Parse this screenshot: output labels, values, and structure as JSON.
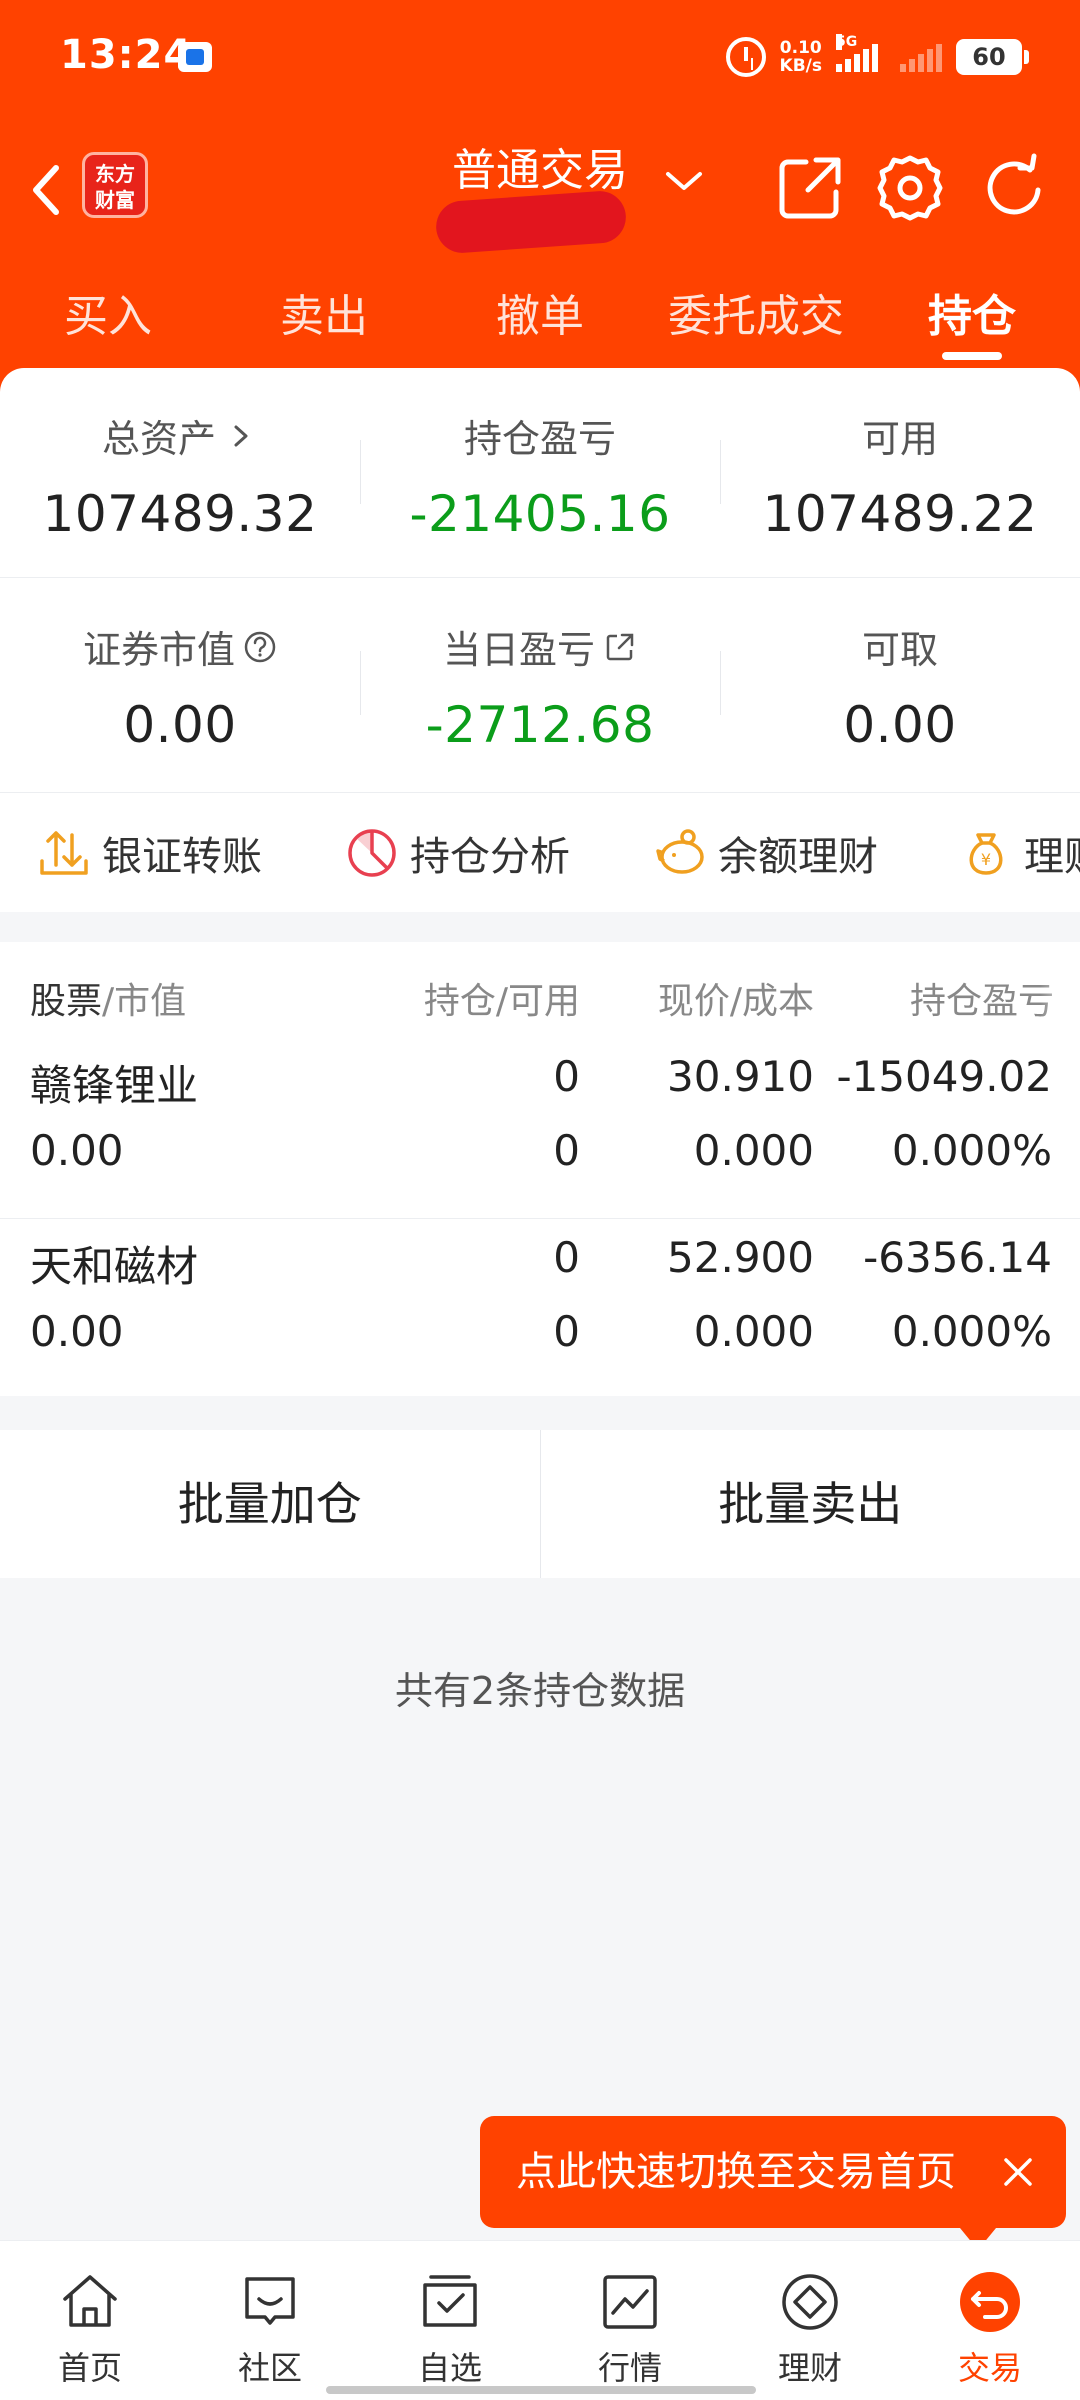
{
  "status_bar": {
    "time": "13:24",
    "net_speed_value": "0.10",
    "net_speed_unit": "KB/s",
    "network": "5G",
    "battery": "60"
  },
  "header": {
    "logo_line1": "东方",
    "logo_line2": "财富",
    "title": "普通交易",
    "tabs": [
      {
        "label": "买入"
      },
      {
        "label": "卖出"
      },
      {
        "label": "撤单"
      },
      {
        "label": "委托成交"
      },
      {
        "label": "持仓",
        "active": true
      }
    ]
  },
  "summary": {
    "total_assets": {
      "label": "总资产",
      "value": "107489.32"
    },
    "position_pnl": {
      "label": "持仓盈亏",
      "value": "-21405.16"
    },
    "available": {
      "label": "可用",
      "value": "107489.22"
    },
    "market_value": {
      "label": "证券市值",
      "value": "0.00"
    },
    "daily_pnl": {
      "label": "当日盈亏",
      "value": "-2712.68"
    },
    "withdrawable": {
      "label": "可取",
      "value": "0.00"
    }
  },
  "quick_actions": [
    {
      "label": "银证转账",
      "icon": "transfer-icon"
    },
    {
      "label": "持仓分析",
      "icon": "pie-chart-icon"
    },
    {
      "label": "余额理财",
      "icon": "piggy-bank-icon"
    },
    {
      "label": "理财",
      "icon": "money-bag-icon"
    }
  ],
  "holdings": {
    "header": {
      "stock": "股票",
      "slash_market_value": "/市值",
      "position": "持仓/可用",
      "price": "现价/成本",
      "pnl": "持仓盈亏"
    },
    "rows": [
      {
        "name": "赣锋锂业",
        "market_value": "0.00",
        "position": "0",
        "available": "0",
        "price": "30.910",
        "cost": "0.000",
        "pnl": "-15049.02",
        "pnl_pct": "0.000%"
      },
      {
        "name": "天和磁材",
        "market_value": "0.00",
        "position": "0",
        "available": "0",
        "price": "52.900",
        "cost": "0.000",
        "pnl": "-6356.14",
        "pnl_pct": "0.000%"
      }
    ]
  },
  "batch": {
    "add": "批量加仓",
    "sell": "批量卖出"
  },
  "count_text": "共有2条持仓数据",
  "tooltip": {
    "text": "点此快速切换至交易首页"
  },
  "bottom_nav": [
    {
      "label": "首页",
      "icon": "home-icon"
    },
    {
      "label": "社区",
      "icon": "community-icon"
    },
    {
      "label": "自选",
      "icon": "watchlist-icon"
    },
    {
      "label": "行情",
      "icon": "market-chart-icon"
    },
    {
      "label": "理财",
      "icon": "wealth-icon"
    },
    {
      "label": "交易",
      "icon": "trade-icon",
      "active": true
    }
  ],
  "colors": {
    "brand": "#ff4200",
    "loss_green": "#0b9d1a"
  }
}
